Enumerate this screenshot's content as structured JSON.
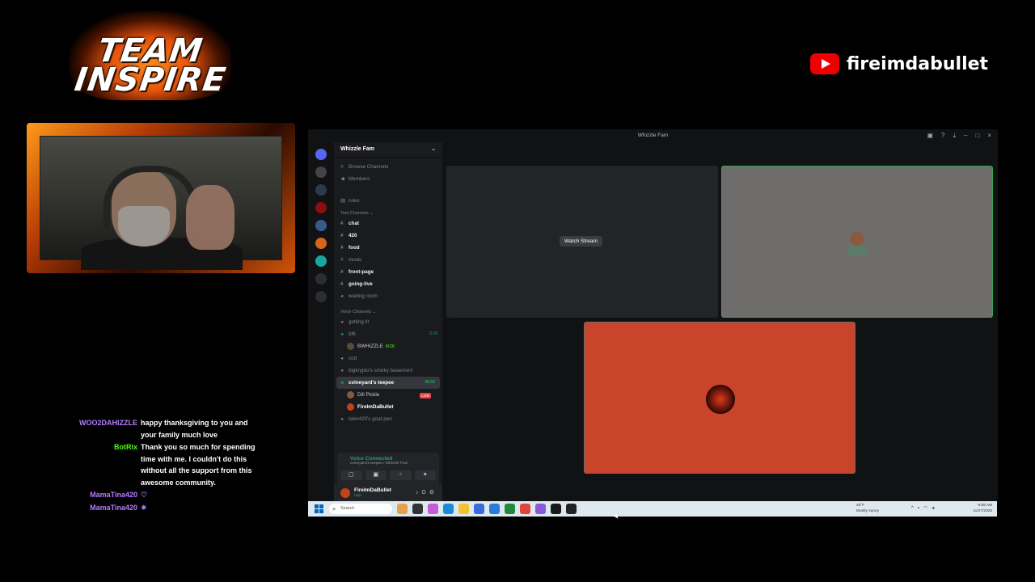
{
  "overlay": {
    "logo_line1": "TEAM",
    "logo_line2": "INSPIRE",
    "channel_name": "fireimdabullet"
  },
  "chat": [
    {
      "user": "WOO2DAHIZZLE",
      "color": "#b57cff",
      "text": "happy thanksgiving to you and your family much love"
    },
    {
      "user": "BotRix",
      "color": "#53fc18",
      "text": "Thank you so much for spending time with me. I couldn't do this without all the support from this awesome community."
    },
    {
      "user": "MamaTina420",
      "color": "#b57cff",
      "text": "♡"
    },
    {
      "user": "MamaTina420",
      "color": "#b57cff",
      "text": "✷"
    }
  ],
  "discord": {
    "window_title": "Whizzle Fam",
    "guild": "Whizzle Fam",
    "browse": "Browse Channels",
    "members": "Members",
    "rules": "rules",
    "text_category": "Text Channels",
    "text_channels": [
      "chat",
      "420",
      "food",
      "music",
      "front-page",
      "going-live",
      "waiting room"
    ],
    "voice_category": "Voice Channels",
    "voice": {
      "getting_lit": "getting lit",
      "bf6": "bf6",
      "bf6_time": "2:18",
      "bf6_user": "BWHIZZLE",
      "bf6_user_tag": "KICK",
      "cod": "cod",
      "bigkrypto": "bigkrypto's smoky basement",
      "teepee": "cvineyard's teepee",
      "teepee_time": "48:52",
      "teepee_user1": "Dill Pickle",
      "teepee_user1_badge": "LIVE",
      "teepee_user2": "FireImDaBullet",
      "goat_pen": "tater420's goat pen"
    },
    "voice_panel": {
      "status": "Voice Connected",
      "sub": "cvineyard's teepee / Whizzle Fam"
    },
    "user": {
      "name": "FireImDaBullet",
      "status": "high"
    },
    "stage": {
      "watch_stream": "Watch Stream"
    }
  },
  "taskbar": {
    "search_placeholder": "Search",
    "weather_temp": "40°F",
    "weather_desc": "Mostly sunny",
    "time": "9:59 AM",
    "date": "11/27/2025"
  }
}
